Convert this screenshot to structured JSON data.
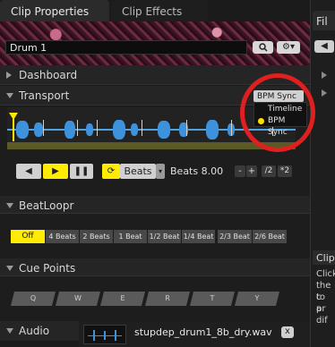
{
  "tabs": [
    {
      "label": "Clip Properties",
      "active": true
    },
    {
      "label": "Clip Effects",
      "active": false
    }
  ],
  "right_tab": {
    "label": "Fil"
  },
  "clip": {
    "name": "Drum 1"
  },
  "icons": {
    "search": "search-icon",
    "settings": "gear-icon",
    "back": "back-icon"
  },
  "sections": {
    "dashboard": "Dashboard",
    "transport": "Transport",
    "beatloopr": "BeatLoopr",
    "cue_points": "Cue Points",
    "audio": "Audio"
  },
  "transport": {
    "sync_dropdown": "BPM Sync",
    "sync_options": [
      {
        "label": "Timeline",
        "selected": false
      },
      {
        "label": "BPM Sync",
        "selected": true
      }
    ],
    "mode_label": "Beats",
    "beats_value": "Beats 8.00",
    "minus": "-",
    "plus": "+",
    "half": "/2",
    "double": "*2"
  },
  "beatloopr": {
    "options": [
      "Off",
      "4 Beats",
      "2 Beats",
      "1 Beat",
      "1/2 Beat",
      "1/4 Beat",
      "2/3 Beat",
      "2/6 Beat"
    ],
    "selected": "Off"
  },
  "cue_points": [
    "Q",
    "W",
    "E",
    "R",
    "T",
    "Y"
  ],
  "audio": {
    "file": "stupdep_drum1_8b_dry.wav",
    "close": "x"
  },
  "right_panel": {
    "clip_label": "Clip",
    "text_lines": [
      "Click",
      "the c",
      "to pr",
      "a dif"
    ]
  },
  "colors": {
    "accent": "#ffec00",
    "waveform": "#3e92dc",
    "highlight_ring": "#e02020"
  }
}
